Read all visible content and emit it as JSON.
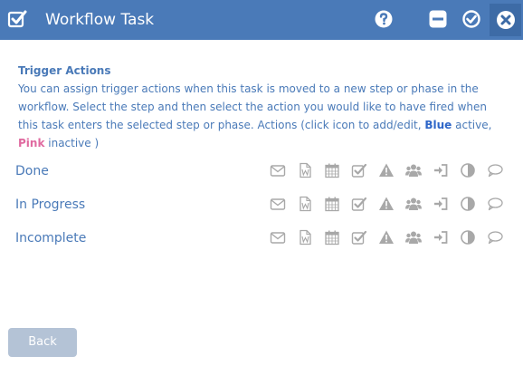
{
  "window": {
    "title": "Workflow Task"
  },
  "intro": {
    "heading": "Trigger Actions",
    "text_1": "You can assign trigger actions when this task is moved to a new step or phase in the workflow. Select the step and then select the action you would like to have fired when this task enters the selected step or phase. Actions  (click icon to add/edit,",
    "blue_word": "Blue",
    "text_2": " active, ",
    "pink_word": "Pink",
    "text_3": " inactive )"
  },
  "steps": [
    {
      "label": "Done"
    },
    {
      "label": "In Progress"
    },
    {
      "label": "Incomplete"
    }
  ],
  "action_icons": [
    "email-icon",
    "word-document-icon",
    "calendar-icon",
    "checkbox-icon",
    "warning-icon",
    "users-group-icon",
    "sign-in-icon",
    "adjust-icon",
    "comment-icon"
  ],
  "footer": {
    "back_label": "Back"
  },
  "colors": {
    "header_bg": "#4a7ab8",
    "text_blue": "#4a7ab8",
    "active_blue": "#2e66c8",
    "inactive_pink": "#e06aa0",
    "icon_gray": "#a8a8a8",
    "button_bg": "#b4c3d6"
  }
}
